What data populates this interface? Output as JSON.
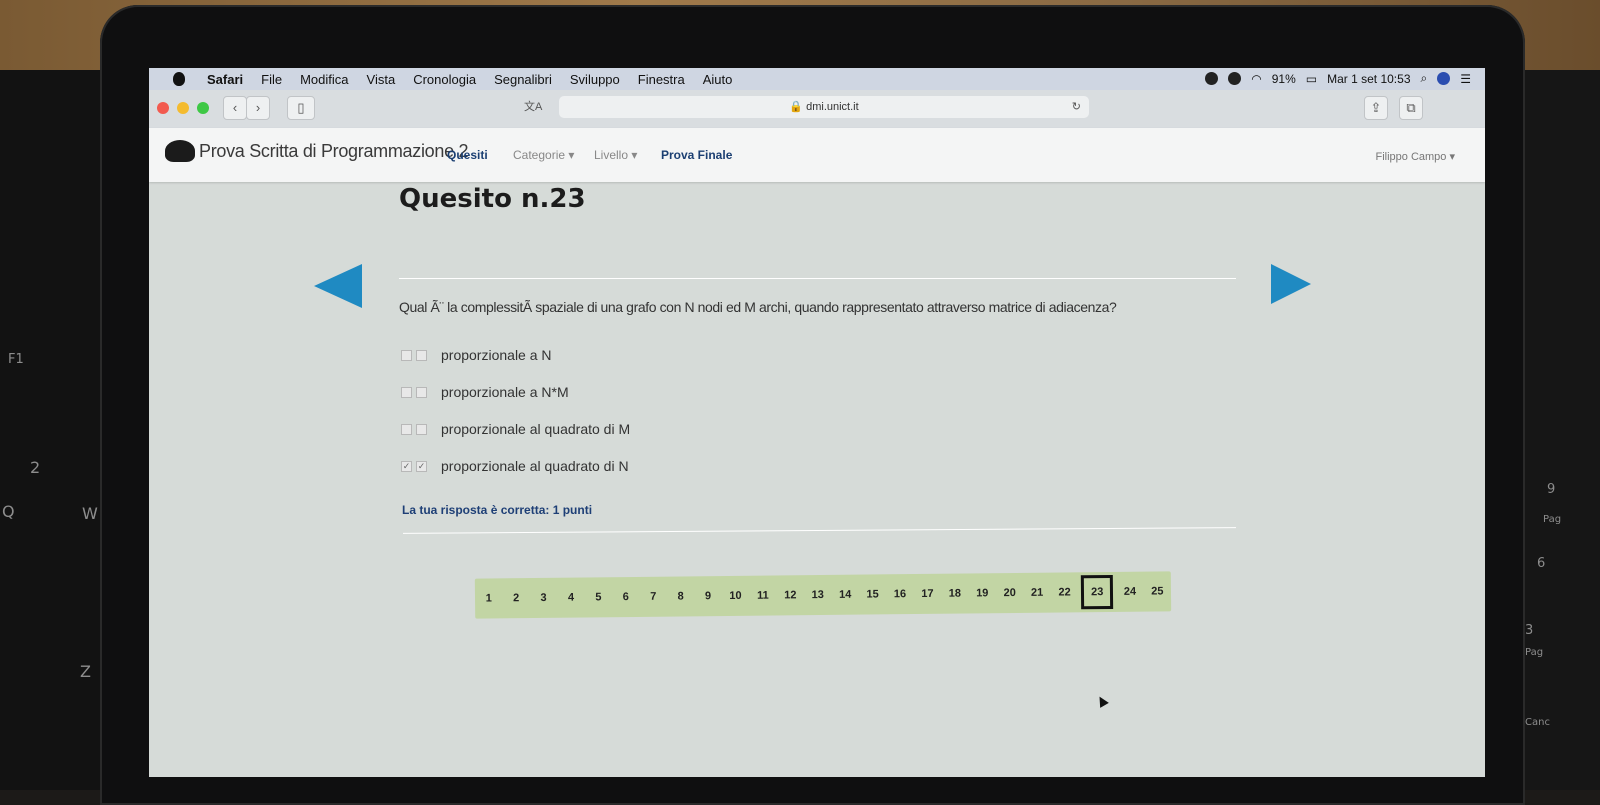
{
  "menubar": {
    "app": "Safari",
    "items": [
      "File",
      "Modifica",
      "Vista",
      "Cronologia",
      "Segnalibri",
      "Sviluppo",
      "Finestra",
      "Aiuto"
    ],
    "battery": "91%",
    "clock": "Mar 1 set  10:53"
  },
  "browser": {
    "url": "dmi.unict.it",
    "translate": "文A"
  },
  "appbar": {
    "brand": "Prova Scritta di Programmazione 2",
    "nav": {
      "quesiti": "Quesiti",
      "categorie": "Categorie ▾",
      "livello": "Livello ▾",
      "prova_finale": "Prova Finale"
    },
    "user": "Filippo Campo ▾"
  },
  "quiz": {
    "title": "Quesito n.23",
    "question": "Qual Ã¨ la complessitÃ  spaziale di una grafo con N nodi ed M archi, quando rappresentato attraverso matrice di adiacenza?",
    "options": [
      {
        "label": "proporzionale a N",
        "checked": false
      },
      {
        "label": "proporzionale a N*M",
        "checked": false
      },
      {
        "label": "proporzionale al quadrato di M",
        "checked": false
      },
      {
        "label": "proporzionale al quadrato di N",
        "checked": true
      }
    ],
    "feedback": "La tua risposta è corretta: 1 punti"
  },
  "pagination": {
    "pages": [
      "1",
      "2",
      "3",
      "4",
      "5",
      "6",
      "7",
      "8",
      "9",
      "10",
      "11",
      "12",
      "13",
      "14",
      "15",
      "16",
      "17",
      "18",
      "19",
      "20",
      "21",
      "22",
      "23",
      "24",
      "25"
    ],
    "current": "23"
  },
  "keyboard_labels": {
    "f1": "F1",
    "k2": "2",
    "kq": "Q",
    "kw": "W",
    "kz": "Z",
    "k9": "9",
    "pag_up": "Pag",
    "k6": "6",
    "k3": "3",
    "pag_down": "Pag",
    "canc": "Canc"
  }
}
